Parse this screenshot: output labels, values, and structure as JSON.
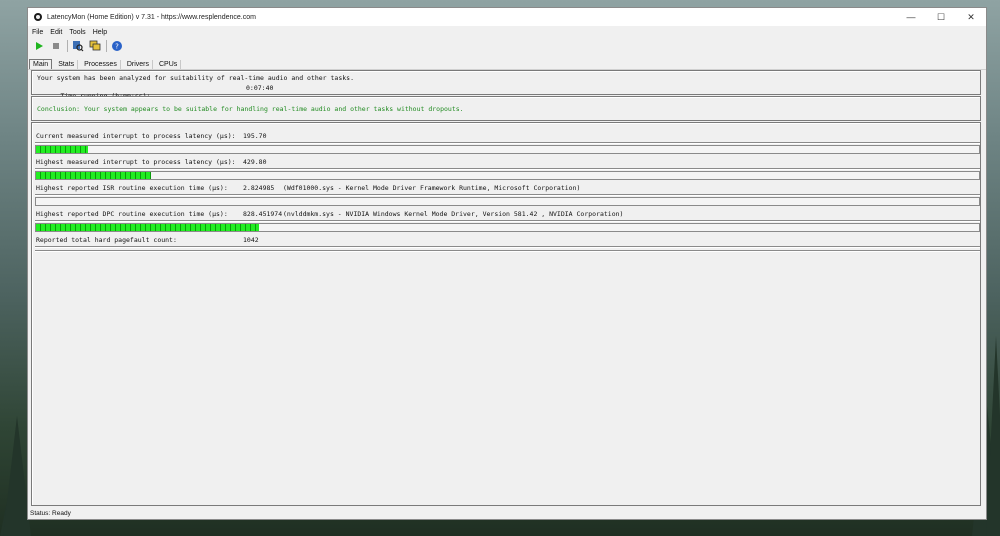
{
  "window": {
    "title": "LatencyMon  (Home Edition)  v 7.31 - https://www.resplendence.com",
    "controls": {
      "minimize": "—",
      "maximize": "☐",
      "close": "✕"
    }
  },
  "menu": {
    "file": "File",
    "edit": "Edit",
    "tools": "Tools",
    "help": "Help"
  },
  "toolbar": {
    "start": "start-icon",
    "stop": "stop-icon",
    "search": "search-icon",
    "windows": "windows-icon",
    "help": "help-icon"
  },
  "tabs": [
    "Main",
    "Stats",
    "Processes",
    "Drivers",
    "CPUs"
  ],
  "summary": {
    "line1": "Your system has been analyzed for suitability of real-time audio and other tasks.",
    "time_label": "Time running (h:mm:ss):",
    "time_value": "0:07:40"
  },
  "conclusion": "Conclusion: Your system appears to be suitable for handling real-time audio and other tasks without dropouts.",
  "metrics": [
    {
      "label": "Current measured interrupt to process latency (µs):",
      "value": "195.70",
      "detail": "",
      "level": 0.055
    },
    {
      "label": "Highest measured interrupt to process latency (µs):",
      "value": "429.80",
      "detail": "",
      "level": 0.122
    },
    {
      "label": "Highest reported ISR routine execution time (µs):",
      "value": "2.824985",
      "detail": "(Wdf01000.sys - Kernel Mode Driver Framework Runtime, Microsoft Corporation)",
      "level": 0
    },
    {
      "label": "Highest reported DPC routine execution time (µs):",
      "value": "828.451974",
      "detail": "(nvlddmkm.sys - NVIDIA Windows Kernel Mode Driver, Version 581.42 , NVIDIA Corporation)",
      "level": 0.236
    },
    {
      "label": "Reported total hard pagefault count:",
      "value": "1042",
      "detail": ""
    }
  ],
  "status": "Status: Ready",
  "colors": {
    "bar": "#22ee22",
    "conclusion": "#1f8a1f"
  }
}
